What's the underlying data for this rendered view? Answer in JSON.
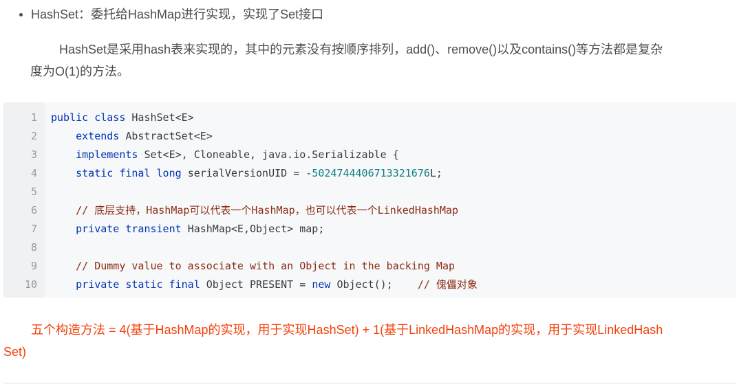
{
  "bullet": {
    "text": "HashSet：委托给HashMap进行实现，实现了Set接口"
  },
  "paragraph": {
    "line1": "HashSet是采用hash表来实现的，其中的元素没有按顺序排列，add()、remove()以及contains()等方法都是复杂",
    "line2": "度为O(1)的方法。"
  },
  "code": {
    "line_numbers": [
      "1",
      "2",
      "3",
      "4",
      "5",
      "6",
      "7",
      "8",
      "9",
      "10"
    ],
    "l1": {
      "kw1": "public",
      "kw2": "class",
      "rest": "HashSet<E>"
    },
    "l2": {
      "kw": "extends",
      "rest": "AbstractSet<E>"
    },
    "l3": {
      "kw": "implements",
      "rest": "Set<E>, Cloneable, java.io.Serializable {"
    },
    "l4": {
      "kw1": "static",
      "kw2": "final",
      "kw3": "long",
      "mid": "serialVersionUID = -",
      "num": "5024744406713321676",
      "end": "L;"
    },
    "l6": {
      "comment": "// 底层支持，HashMap可以代表一个HashMap，也可以代表一个LinkedHashMap"
    },
    "l7": {
      "kw1": "private",
      "kw2": "transient",
      "rest": "HashMap<E,Object> map;"
    },
    "l9": {
      "comment": "// Dummy value to associate with an Object in the backing Map"
    },
    "l10": {
      "kw1": "private",
      "kw2": "static",
      "kw3": "final",
      "mid": "Object PRESENT = ",
      "kw4": "new",
      "end": "Object();",
      "comment": "// 傀儡对象"
    }
  },
  "note": {
    "line1": "五个构造方法 = 4(基于HashMap的实现，用于实现HashSet) + 1(基于LinkedHashMap的实现，用于实现LinkedHash",
    "line2": "Set)"
  }
}
